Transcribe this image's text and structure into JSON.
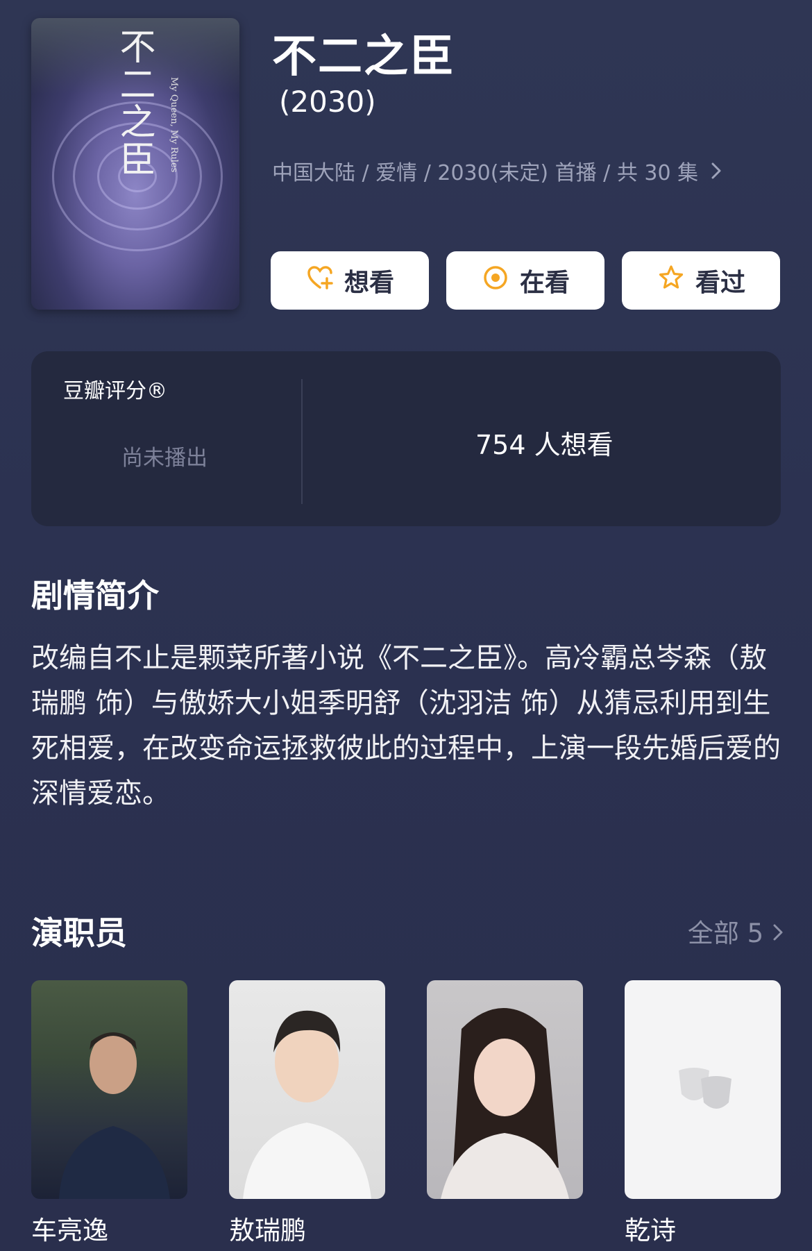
{
  "show": {
    "title": "不二之臣",
    "year": "(2030)",
    "meta": "中国大陆 / 爱情 / 2030(未定) 首播 / 共 30 集",
    "poster": {
      "title_vertical": "不二之臣",
      "subtitle": "My Queen, My Rules"
    }
  },
  "actions": {
    "want_label": "想看",
    "watching_label": "在看",
    "watched_label": "看过",
    "accent_color": "#f5a623"
  },
  "rating": {
    "label": "豆瓣评分®",
    "status": "尚未播出",
    "want_count": "754 人想看"
  },
  "synopsis": {
    "heading": "剧情简介",
    "text": "改编自不止是颗菜所著小说《不二之臣》。高冷霸总岑森（敖瑞鹏 饰）与傲娇大小姐季明舒（沈羽洁 饰）从猜忌利用到生死相爱，在改变命运拯救彼此的过程中，上演一段先婚后爱的深情爱恋。"
  },
  "cast": {
    "heading": "演职员",
    "see_all": "全部 5",
    "members": [
      {
        "name": "车亮逸"
      },
      {
        "name": "敖瑞鹏"
      },
      {
        "name": ""
      },
      {
        "name": "乾诗"
      }
    ]
  },
  "icons": [
    "heart-plus-icon",
    "watching-icon",
    "star-icon",
    "chevron-right-icon",
    "drama-mask-icon"
  ]
}
